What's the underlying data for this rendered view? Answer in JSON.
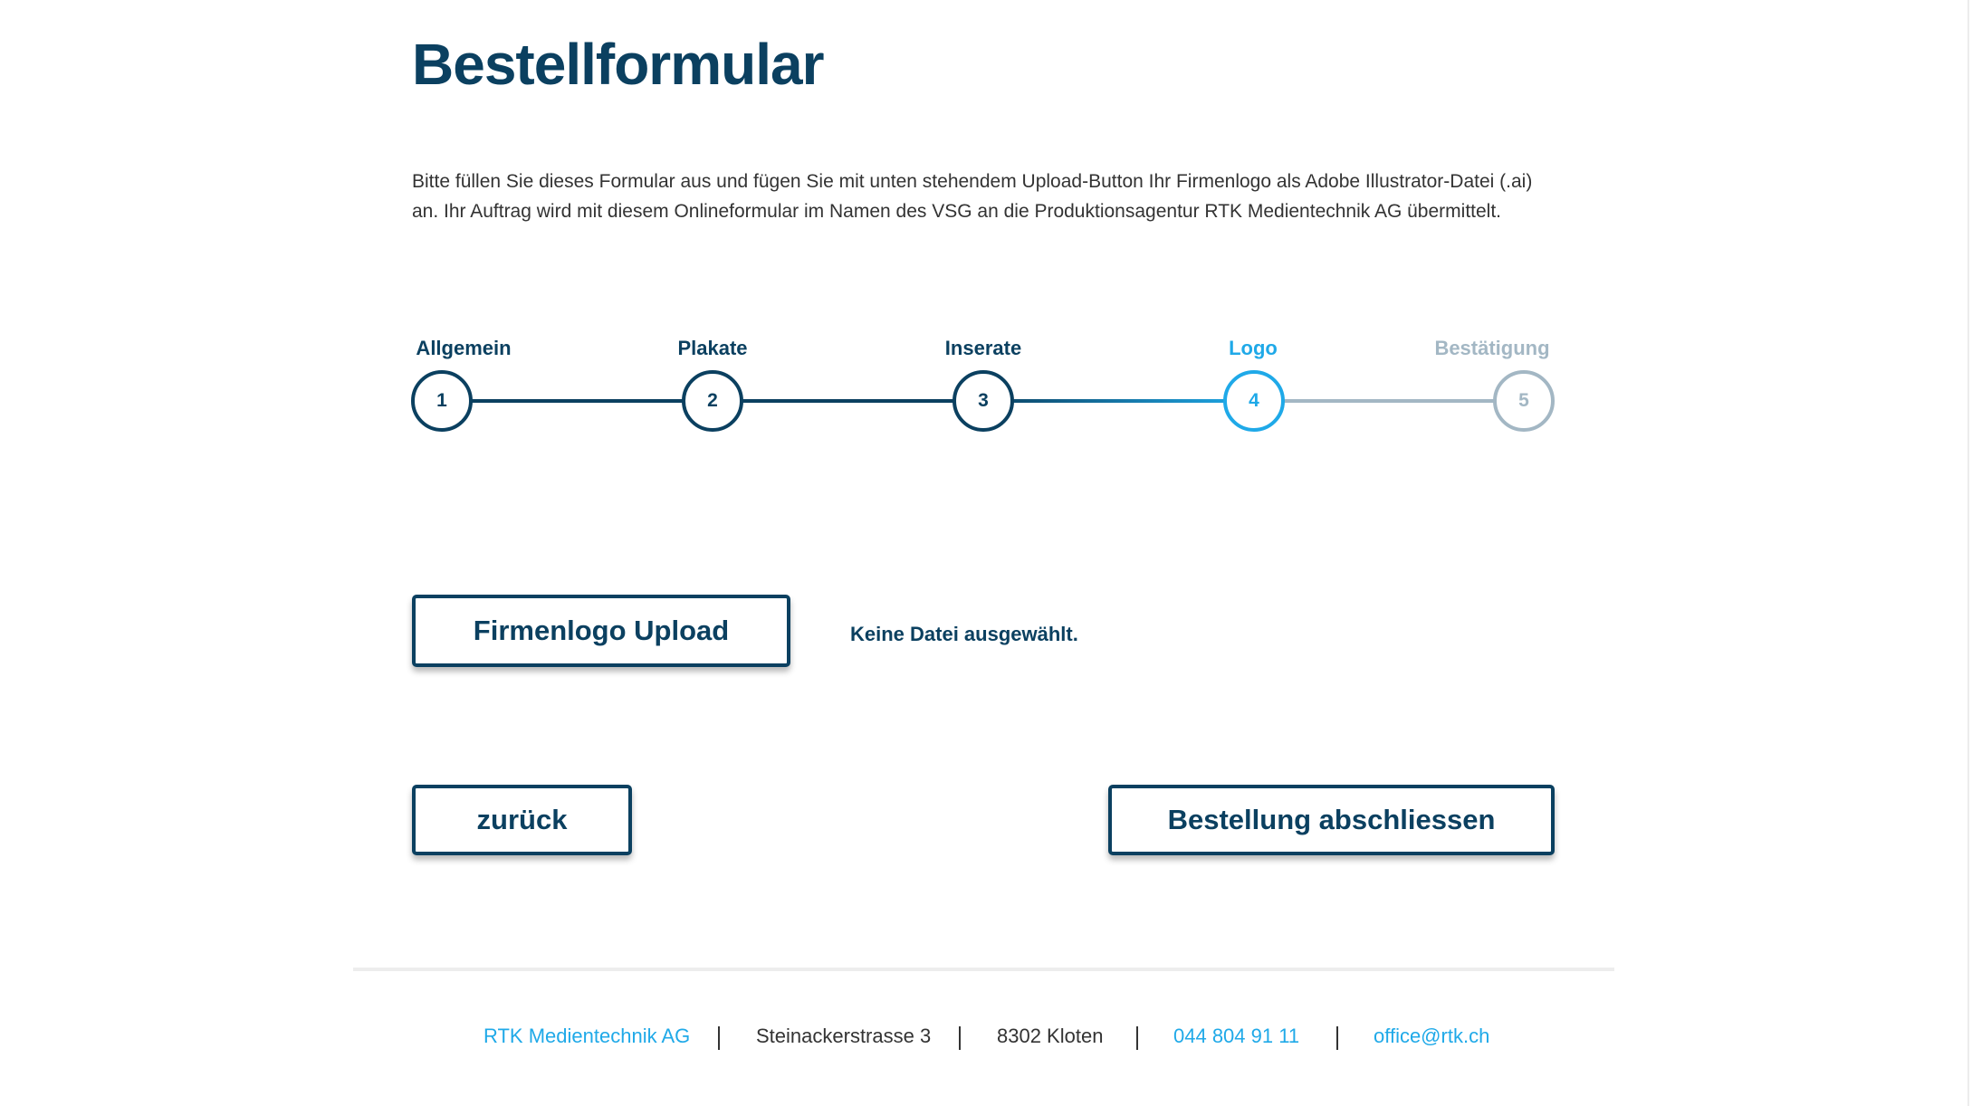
{
  "header": {
    "title": "Bestellformular",
    "intro_line1": "Bitte füllen Sie dieses Formular aus und fügen Sie mit unten stehendem Upload-Button Ihr Firmenlogo als Adobe Illustrator-Datei (.ai)",
    "intro_line2": "an. Ihr Auftrag wird mit diesem Onlineformular im Namen des VSG an die Produktionsagentur RTK Medientechnik AG übermittelt."
  },
  "stepper": {
    "current_step": 4,
    "steps": [
      {
        "number": "1",
        "label": "Allgemein",
        "state": "done"
      },
      {
        "number": "2",
        "label": "Plakate",
        "state": "done"
      },
      {
        "number": "3",
        "label": "Inserate",
        "state": "done"
      },
      {
        "number": "4",
        "label": "Logo",
        "state": "active"
      },
      {
        "number": "5",
        "label": "Bestätigung",
        "state": "todo"
      }
    ]
  },
  "upload": {
    "button_label": "Firmenlogo Upload",
    "status_text": "Keine Datei ausgewählt."
  },
  "navigation": {
    "back_label": "zurück",
    "submit_label": "Bestellung abschliessen"
  },
  "footer": {
    "company": "RTK Medientechnik AG",
    "street": "Steinackerstrasse 3",
    "city": "8302 Kloten",
    "phone": "044 804 91 11",
    "email": "office@rtk.ch"
  },
  "colors": {
    "primary": "#0b4060",
    "accent": "#1fa9e8",
    "inactive": "#a3b7c4",
    "text": "#333333"
  }
}
